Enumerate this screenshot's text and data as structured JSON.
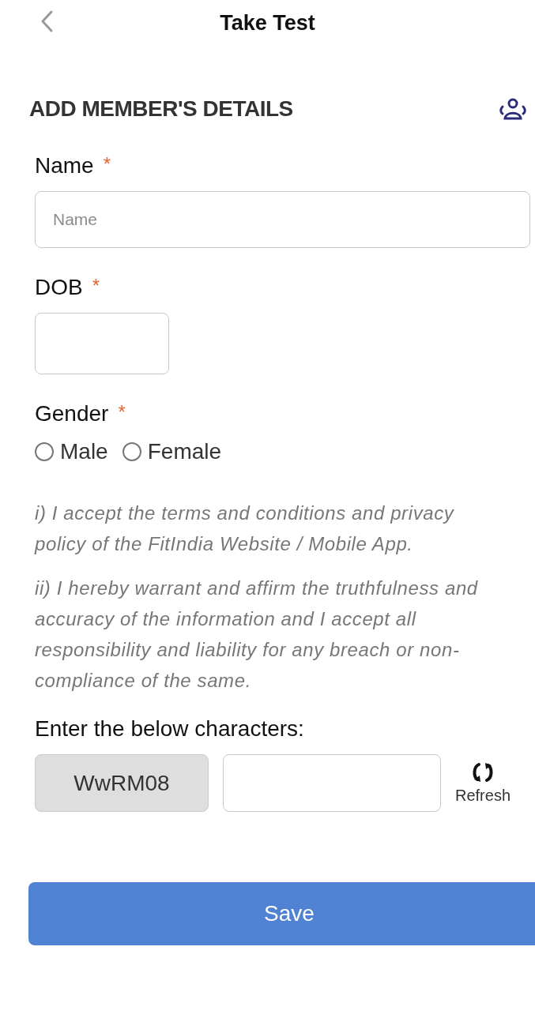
{
  "header": {
    "title": "Take Test"
  },
  "section": {
    "title": "ADD MEMBER'S DETAILS"
  },
  "fields": [
    {
      "kind": "text",
      "label": "Name",
      "required_mark": "*",
      "placeholder": "Name"
    },
    {
      "kind": "date",
      "label": "DOB",
      "required_mark": "*"
    },
    {
      "kind": "radio",
      "label": "Gender",
      "required_mark": "*",
      "options": [
        {
          "label": "Male",
          "selected": false
        },
        {
          "label": "Female",
          "selected": false
        }
      ]
    }
  ],
  "terms": [
    "i) I accept the terms and conditions and privacy policy of the FitIndia Website / Mobile App.",
    "ii) I hereby warrant and affirm the truthfulness and accuracy of the information and I accept all responsibility and liability for any breach or non-compliance of the same."
  ],
  "captcha": {
    "label": "Enter the below characters:",
    "code": "WwRM08",
    "refresh": "Refresh"
  },
  "save_button": "Save"
}
